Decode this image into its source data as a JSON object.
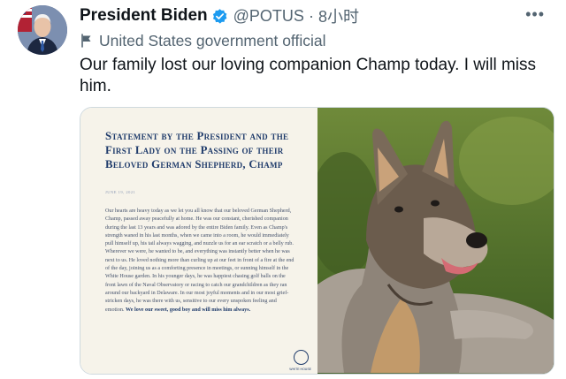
{
  "tweet": {
    "display_name": "President Biden",
    "handle": "@POTUS",
    "separator": "·",
    "time": "8小时",
    "more_icon": "more-icon",
    "label": "United States government official",
    "label_icon": "flag-icon",
    "verified_icon": "verified-badge-icon",
    "text": "Our family lost our loving companion Champ today. I will miss him."
  },
  "statement": {
    "title": "Statement by the President and the First Lady on the Passing of their Beloved German Shepherd, Champ",
    "date": "JUNE 19, 2021",
    "body": "Our hearts are heavy today as we let you all know that our beloved German Shepherd, Champ, passed away peacefully at home. He was our constant, cherished companion during the last 13 years and was adored by the entire Biden family. Even as Champ's strength waned in his last months, when we came into a room, he would immediately pull himself up, his tail always wagging, and nuzzle us for an ear scratch or a belly rub. Wherever we were, he wanted to be, and everything was instantly better when he was next to us. He loved nothing more than curling up at our feet in front of a fire at the end of the day, joining us as a comforting presence in meetings, or sunning himself in the White House garden. In his younger days, he was happiest chasing golf balls on the front lawn of the Naval Observatory or racing to catch our grandchildren as they ran around our backyard in Delaware. In our most joyful moments and in our most grief-stricken days, he was there with us, sensitive to our every unspoken feeling and emotion.",
    "closing": "We love our sweet, good boy and will miss him always.",
    "seal_caption": "WHITE HOUSE",
    "seal_icon": "white-house-seal-icon"
  },
  "colors": {
    "link_gray": "#536471",
    "text": "#0f1419",
    "verified_blue": "#1d9bf0",
    "statement_navy": "#1f3b6b",
    "statement_bg": "#f6f3ea"
  }
}
